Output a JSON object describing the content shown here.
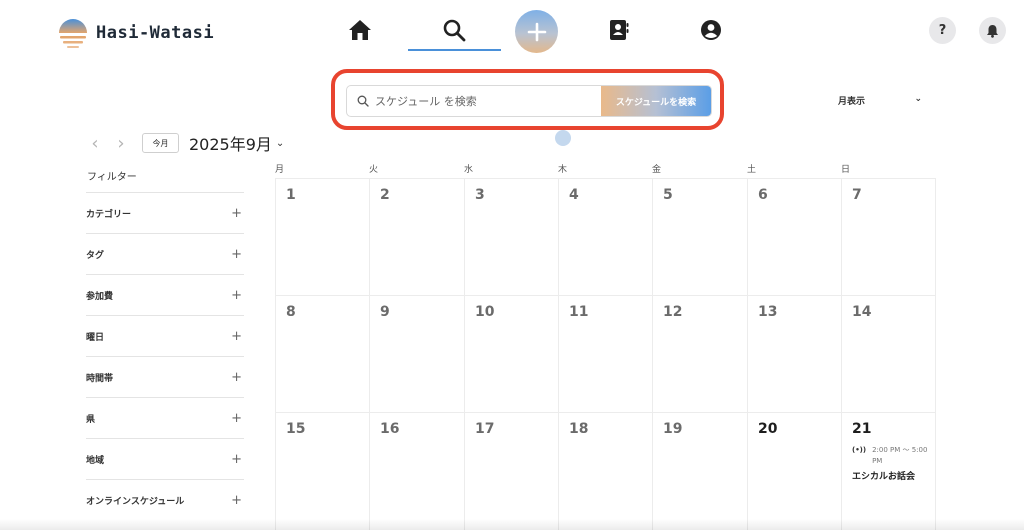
{
  "app": {
    "name": "Hasi-Watasi"
  },
  "nav": {
    "items": [
      {
        "icon": "home-icon"
      },
      {
        "icon": "search-icon",
        "active": true
      },
      {
        "icon": "plus-icon"
      },
      {
        "icon": "contacts-icon"
      },
      {
        "icon": "user-icon"
      }
    ],
    "help_label": "?",
    "colors": {
      "accent": "#4a90d9",
      "highlight": "#e8442f"
    }
  },
  "search": {
    "placeholder": "スケジュール を検索",
    "value": "",
    "button_label": "スケジュールを検索"
  },
  "view": {
    "selected": "月表示",
    "caret": "⌄"
  },
  "month": {
    "today_label": "今月",
    "title": "2025年9月",
    "caret": "⌄",
    "prev": "‹",
    "next": "›"
  },
  "filter": {
    "title": "フィルター",
    "plus": "+",
    "items": [
      "カテゴリー",
      "タグ",
      "参加費",
      "曜日",
      "時間帯",
      "県",
      "地域",
      "オンラインスケジュール"
    ]
  },
  "calendar": {
    "weekdays": [
      "月",
      "火",
      "水",
      "木",
      "金",
      "土",
      "日"
    ],
    "weeks": [
      [
        "1",
        "2",
        "3",
        "4",
        "5",
        "6",
        "7"
      ],
      [
        "8",
        "9",
        "10",
        "11",
        "12",
        "13",
        "14"
      ],
      [
        "15",
        "16",
        "17",
        "18",
        "19",
        "20",
        "21"
      ]
    ],
    "event": {
      "icon": "(•))",
      "time": "2:00 PM 〜 5:00 PM",
      "title": "エシカルお話会"
    }
  }
}
